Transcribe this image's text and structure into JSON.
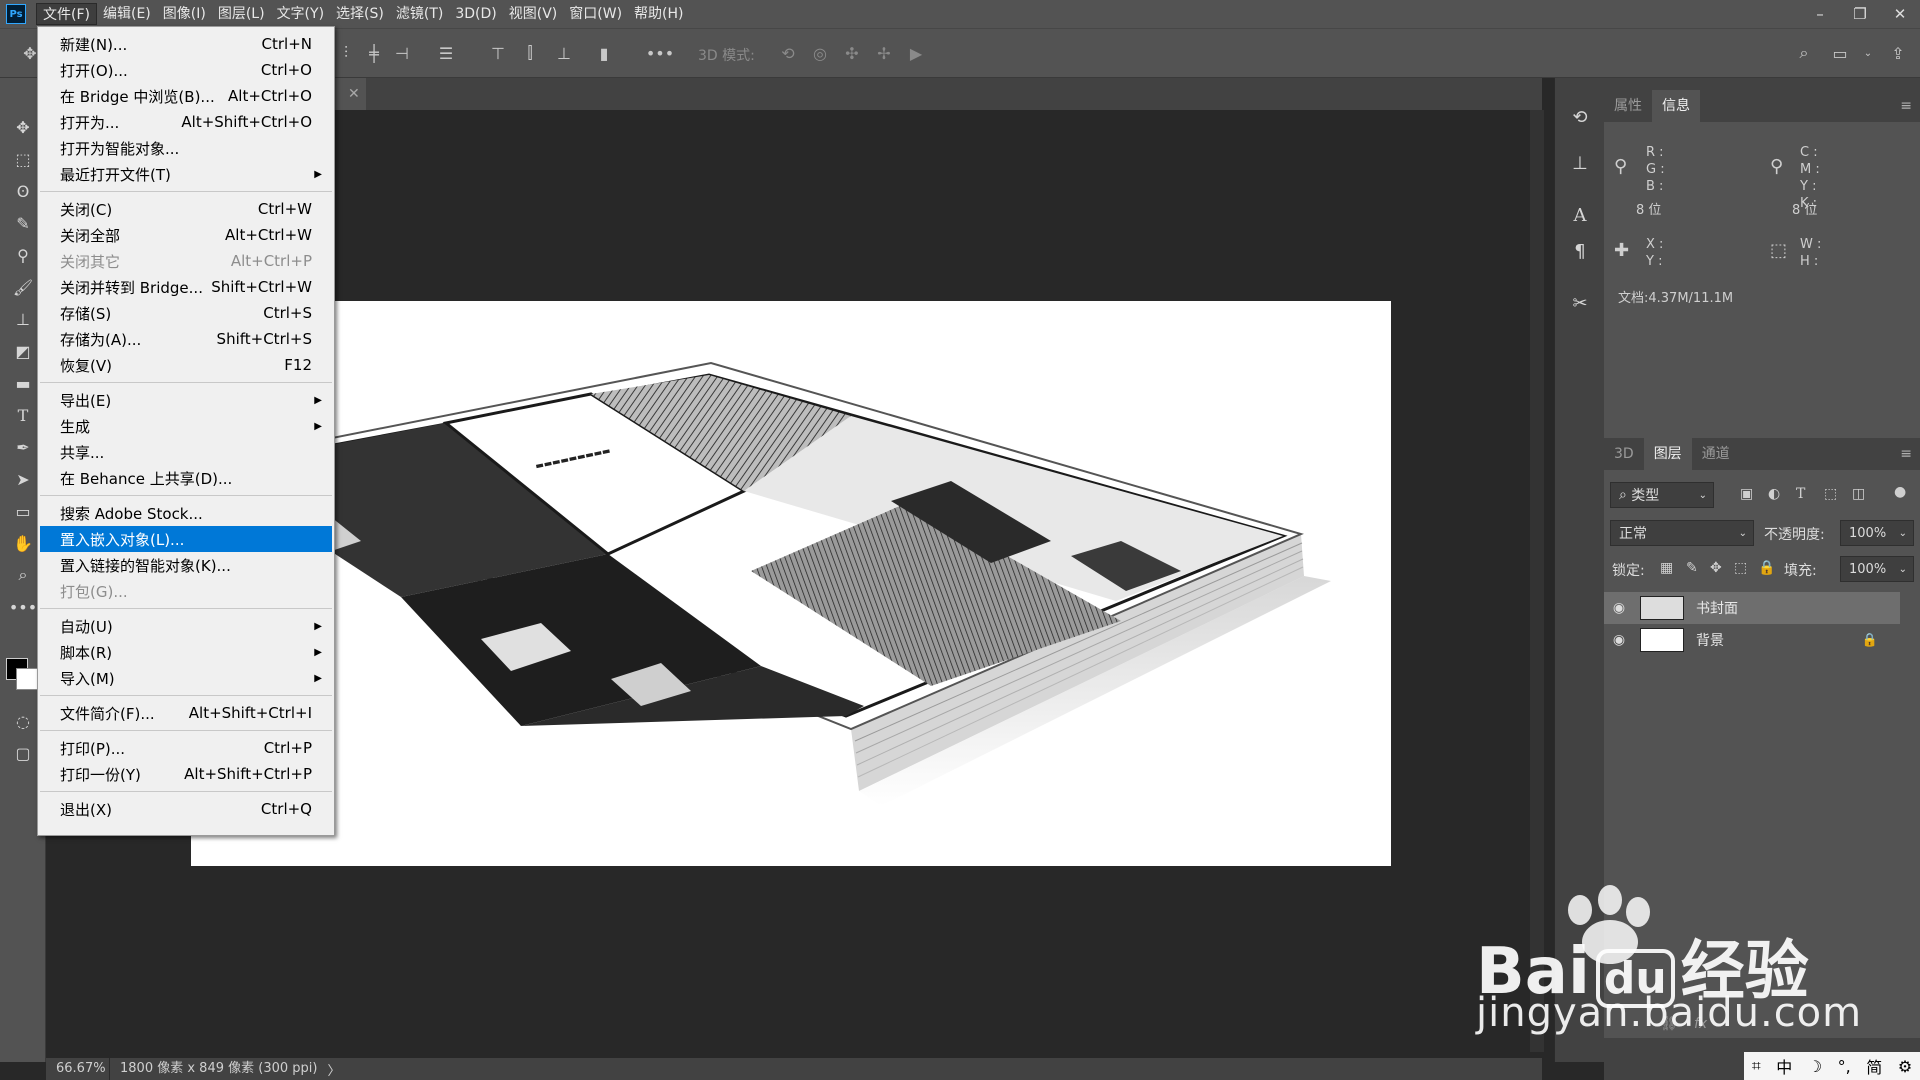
{
  "app": {
    "logo": "Ps"
  },
  "menubar": {
    "items": [
      "文件(F)",
      "编辑(E)",
      "图像(I)",
      "图层(L)",
      "文字(Y)",
      "选择(S)",
      "滤镜(T)",
      "3D(D)",
      "视图(V)",
      "窗口(W)",
      "帮助(H)"
    ],
    "open_index": 0
  },
  "window_controls": {
    "minimize": "–",
    "restore": "❐",
    "close": "✕"
  },
  "options_bar": {
    "mode_3d_label": "3D 模式:"
  },
  "file_menu": {
    "items": [
      {
        "label": "新建(N)...",
        "shortcut": "Ctrl+N"
      },
      {
        "label": "打开(O)...",
        "shortcut": "Ctrl+O"
      },
      {
        "label": "在 Bridge 中浏览(B)...",
        "shortcut": "Alt+Ctrl+O"
      },
      {
        "label": "打开为...",
        "shortcut": "Alt+Shift+Ctrl+O"
      },
      {
        "label": "打开为智能对象...",
        "shortcut": ""
      },
      {
        "label": "最近打开文件(T)",
        "shortcut": "",
        "submenu": true
      },
      {
        "label": "关闭(C)",
        "shortcut": "Ctrl+W"
      },
      {
        "label": "关闭全部",
        "shortcut": "Alt+Ctrl+W"
      },
      {
        "label": "关闭其它",
        "shortcut": "Alt+Ctrl+P",
        "disabled": true
      },
      {
        "label": "关闭并转到 Bridge...",
        "shortcut": "Shift+Ctrl+W"
      },
      {
        "label": "存储(S)",
        "shortcut": "Ctrl+S"
      },
      {
        "label": "存储为(A)...",
        "shortcut": "Shift+Ctrl+S"
      },
      {
        "label": "恢复(V)",
        "shortcut": "F12"
      },
      {
        "label": "导出(E)",
        "shortcut": "",
        "submenu": true
      },
      {
        "label": "生成",
        "shortcut": "",
        "submenu": true
      },
      {
        "label": "共享...",
        "shortcut": ""
      },
      {
        "label": "在 Behance 上共享(D)...",
        "shortcut": ""
      },
      {
        "label": "搜索 Adobe Stock...",
        "shortcut": ""
      },
      {
        "label": "置入嵌入对象(L)...",
        "shortcut": "",
        "highlighted": true
      },
      {
        "label": "置入链接的智能对象(K)...",
        "shortcut": ""
      },
      {
        "label": "打包(G)...",
        "shortcut": "",
        "disabled": true
      },
      {
        "label": "自动(U)",
        "shortcut": "",
        "submenu": true
      },
      {
        "label": "脚本(R)",
        "shortcut": "",
        "submenu": true
      },
      {
        "label": "导入(M)",
        "shortcut": "",
        "submenu": true
      },
      {
        "label": "文件简介(F)...",
        "shortcut": "Alt+Shift+Ctrl+I"
      },
      {
        "label": "打印(P)...",
        "shortcut": "Ctrl+P"
      },
      {
        "label": "打印一份(Y)",
        "shortcut": "Alt+Shift+Ctrl+P"
      },
      {
        "label": "退出(X)",
        "shortcut": "Ctrl+Q"
      }
    ]
  },
  "status_bar": {
    "zoom": "66.67%",
    "doc_info": "1800 像素 x 849 像素 (300 ppi)",
    "arrow": "〉"
  },
  "info_panel": {
    "tabs": [
      "属性",
      "信息"
    ],
    "active_tab": 1,
    "rgb_labels": "R :\nG :\nB :",
    "cmyk_labels": "C :\nM :\nY :\nK :",
    "bit_depth_left": "8 位",
    "bit_depth_right": "8 位",
    "xy_labels": "X :\nY :",
    "wh_labels": "W :\nH :",
    "doc_size": "文档:4.37M/11.1M"
  },
  "layers_panel": {
    "tabs": [
      "3D",
      "图层",
      "通道"
    ],
    "active_tab": 1,
    "filter_label": "类型",
    "blend_mode": "正常",
    "opacity_label": "不透明度:",
    "opacity_value": "100%",
    "lock_label": "锁定:",
    "fill_label": "填充:",
    "fill_value": "100%",
    "layers": [
      {
        "name": "书封面",
        "selected": true,
        "locked": false
      },
      {
        "name": "背景",
        "selected": false,
        "locked": true
      }
    ]
  },
  "watermark": {
    "brand": "Bai",
    "brand_suffix": "经验",
    "domain": "jingyan.baidu.com"
  },
  "icons": {
    "move": "move-icon",
    "marquee": "marquee-icon",
    "lasso": "lasso-icon",
    "quick-select": "quick-select-icon",
    "eyedropper": "eyedropper-icon",
    "brush": "brush-icon",
    "stamp": "stamp-icon",
    "eraser": "eraser-icon",
    "gradient": "gradient-icon",
    "type": "type-icon",
    "pen": "pen-icon",
    "path-select": "path-select-icon",
    "rectangle": "rectangle-icon",
    "hand": "hand-icon",
    "zoom": "zoom-icon",
    "more": "more-icon"
  }
}
